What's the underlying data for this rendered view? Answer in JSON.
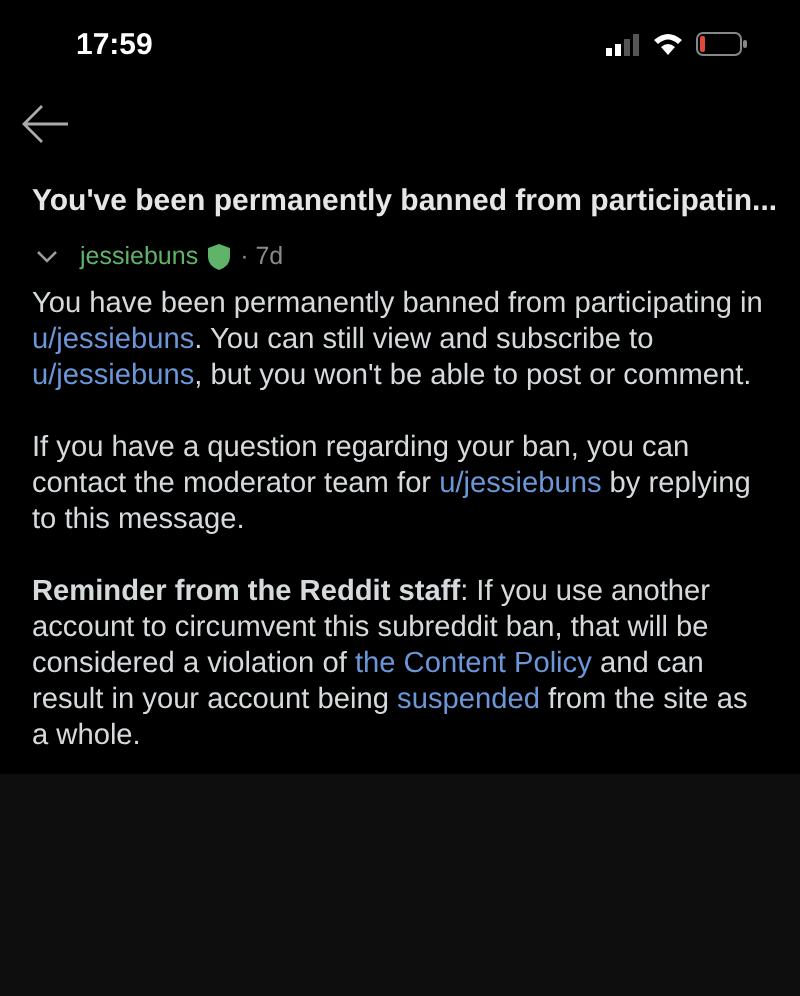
{
  "status_bar": {
    "time": "17:59"
  },
  "title": "You've been permanently banned from participatin...",
  "message": {
    "expanded": true,
    "author": "jessiebuns",
    "moderator": true,
    "age": "· 7d",
    "paragraphs": [
      [
        {
          "kind": "text",
          "text": "You have been permanently banned from participating in "
        },
        {
          "kind": "link",
          "text": "u/jessiebuns"
        },
        {
          "kind": "text",
          "text": ". You can still view and subscribe to "
        },
        {
          "kind": "link",
          "text": "u/jessiebuns"
        },
        {
          "kind": "text",
          "text": ", but you won't be able to post or comment."
        }
      ],
      [
        {
          "kind": "text",
          "text": "If you have a question regarding your ban, you can contact the moderator team for "
        },
        {
          "kind": "link",
          "text": "u/jessiebuns"
        },
        {
          "kind": "text",
          "text": " by replying to this message."
        }
      ],
      [
        {
          "kind": "bold",
          "text": "Reminder from the Reddit staff"
        },
        {
          "kind": "text",
          "text": ": If you use another account to circumvent this subreddit ban, that will be considered a violation of "
        },
        {
          "kind": "link",
          "text": "the Content Policy"
        },
        {
          "kind": "text",
          "text": " and can result in your account being "
        },
        {
          "kind": "link",
          "text": "suspended"
        },
        {
          "kind": "text",
          "text": " from the site as a whole."
        }
      ]
    ]
  }
}
